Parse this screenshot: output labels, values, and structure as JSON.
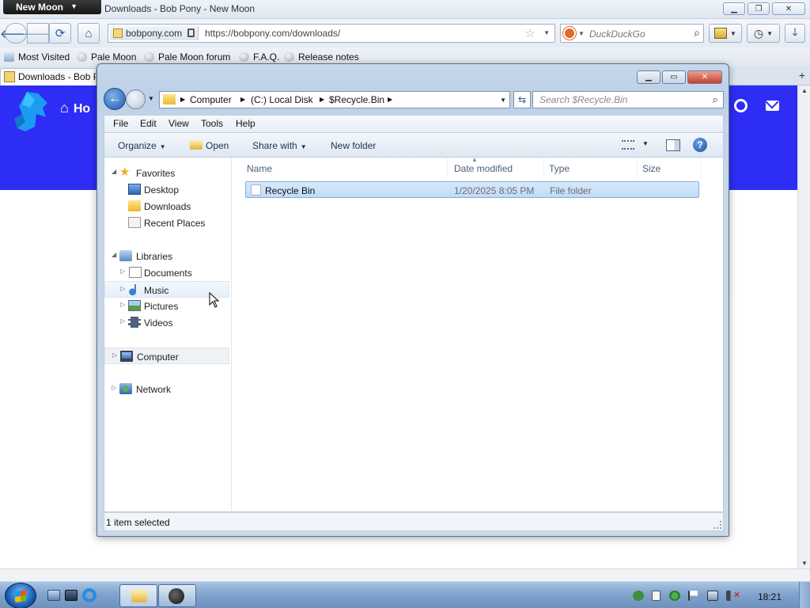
{
  "browser": {
    "app_menu": "New Moon",
    "title": "Downloads - Bob Pony - New Moon",
    "site_identity": "bobpony.com",
    "url": "https://bobpony.com/downloads/",
    "search_placeholder": "DuckDuckGo",
    "bookmarks": [
      "Most Visited",
      "Pale Moon",
      "Pale Moon forum",
      "F.A.Q.",
      "Release notes"
    ],
    "tab_title": "Downloads - Bob Pony",
    "page_home_label": "Ho"
  },
  "explorer": {
    "breadcrumb": [
      "Computer",
      "(C:) Local Disk",
      "$Recycle.Bin"
    ],
    "search_placeholder": "Search $Recycle.Bin",
    "menu": [
      "File",
      "Edit",
      "View",
      "Tools",
      "Help"
    ],
    "commands": {
      "organize": "Organize",
      "open": "Open",
      "share_with": "Share with",
      "new_folder": "New folder"
    },
    "nav_tree": {
      "favorites": "Favorites",
      "desktop": "Desktop",
      "downloads": "Downloads",
      "recent_places": "Recent Places",
      "libraries": "Libraries",
      "documents": "Documents",
      "music": "Music",
      "pictures": "Pictures",
      "videos": "Videos",
      "computer": "Computer",
      "network": "Network"
    },
    "columns": [
      "Name",
      "Date modified",
      "Type",
      "Size"
    ],
    "files": [
      {
        "name": "Recycle Bin",
        "date_modified": "1/20/2025 8:05 PM",
        "type": "File folder",
        "size": ""
      }
    ],
    "status": "1 item selected"
  },
  "taskbar": {
    "clock": "18:21"
  }
}
